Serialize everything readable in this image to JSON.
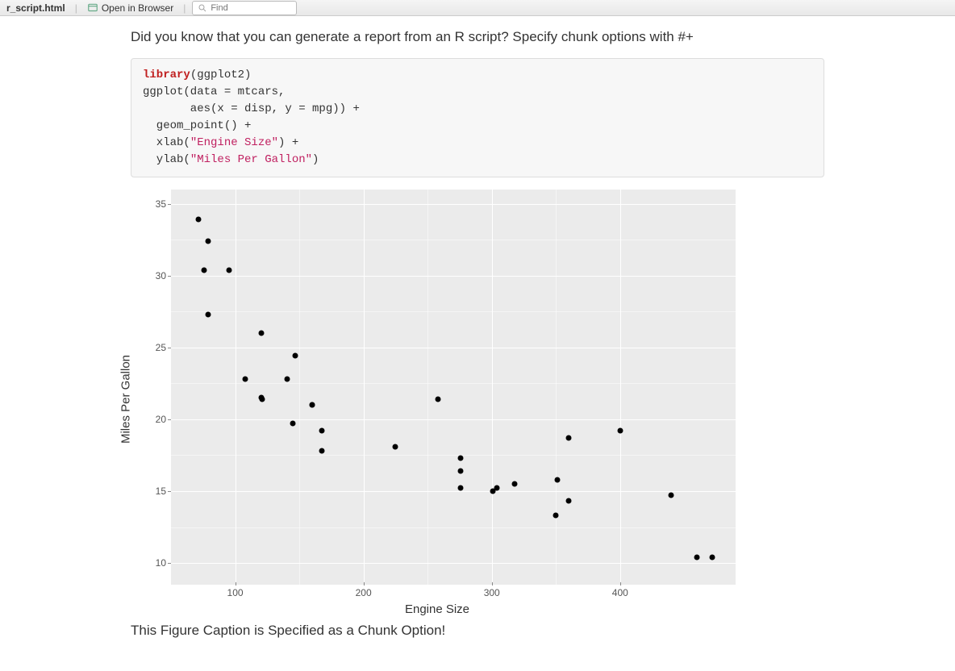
{
  "toolbar": {
    "filename": "r_script.html",
    "open_in_browser": "Open in Browser",
    "find_placeholder": "Find"
  },
  "intro": "Did you know that you can generate a report from an R script? Specify chunk options with #+",
  "code": {
    "l1a": "library",
    "l1b": "(ggplot2)",
    "l2": "ggplot(data = mtcars,",
    "l3": "       aes(x = disp, y = mpg)) +",
    "l4": "  geom_point() +",
    "l5a": "  xlab(",
    "l5b": "\"Engine Size\"",
    "l5c": ") +",
    "l6a": "  ylab(",
    "l6b": "\"Miles Per Gallon\"",
    "l6c": ")"
  },
  "caption": "This Figure Caption is Specified as a Chunk Option!",
  "watermark": "",
  "chart_data": {
    "type": "scatter",
    "title": "",
    "xlabel": "Engine Size",
    "ylabel": "Miles Per Gallon",
    "xlim": [
      50,
      490
    ],
    "ylim": [
      8.5,
      36
    ],
    "x_ticks": [
      100,
      200,
      300,
      400
    ],
    "y_ticks": [
      10,
      15,
      20,
      25,
      30,
      35
    ],
    "x": [
      160,
      160,
      108,
      258,
      360,
      225,
      360,
      146.7,
      140.8,
      167.6,
      167.6,
      275.8,
      275.8,
      275.8,
      472,
      460,
      440,
      78.7,
      75.7,
      71.1,
      120.1,
      318,
      304,
      350,
      400,
      79,
      120.3,
      95.1,
      351,
      145,
      301,
      121
    ],
    "y": [
      21,
      21,
      22.8,
      21.4,
      18.7,
      18.1,
      14.3,
      24.4,
      22.8,
      19.2,
      17.8,
      16.4,
      17.3,
      15.2,
      10.4,
      10.4,
      14.7,
      32.4,
      30.4,
      33.9,
      21.5,
      15.5,
      15.2,
      13.3,
      19.2,
      27.3,
      26,
      30.4,
      15.8,
      19.7,
      15,
      21.4
    ]
  }
}
